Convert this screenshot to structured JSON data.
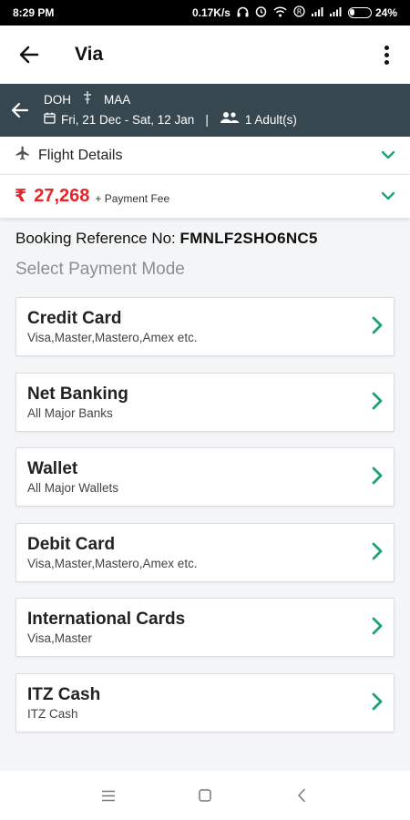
{
  "status_bar": {
    "time": "8:29 PM",
    "speed": "0.17K/s",
    "battery_text": "24%",
    "battery_level": 0.24,
    "icons": [
      "headphones-icon",
      "alarm-icon",
      "wifi-icon",
      "r-badge-icon",
      "signal-icon",
      "signal-icon",
      "battery-icon"
    ]
  },
  "app_bar": {
    "title": "Via",
    "back_icon": "arrow-left-icon",
    "menu_icon": "more-vertical-icon"
  },
  "trip": {
    "from": "DOH",
    "to": "MAA",
    "dates": "Fri, 21 Dec - Sat, 12 Jan",
    "separator": "|",
    "travellers": "1 Adult(s)"
  },
  "flight_details": {
    "label": "Flight Details"
  },
  "fare": {
    "currency_symbol": "₹",
    "amount": "27,268",
    "fee_note": "+ Payment Fee"
  },
  "booking": {
    "label": "Booking Reference No:",
    "reference": "FMNLF2SHO6NC5"
  },
  "payment": {
    "heading": "Select Payment Mode",
    "modes": [
      {
        "title": "Credit Card",
        "subtitle": "Visa,Master,Mastero,Amex etc."
      },
      {
        "title": "Net Banking",
        "subtitle": "All Major Banks"
      },
      {
        "title": "Wallet",
        "subtitle": "All Major Wallets"
      },
      {
        "title": "Debit Card",
        "subtitle": "Visa,Master,Mastero,Amex etc."
      },
      {
        "title": "International Cards",
        "subtitle": "Visa,Master"
      },
      {
        "title": "ITZ Cash",
        "subtitle": "ITZ Cash"
      }
    ]
  },
  "colors": {
    "accent": "#1aa37a",
    "trip_bar": "#37474f",
    "price": "#e4262b"
  }
}
